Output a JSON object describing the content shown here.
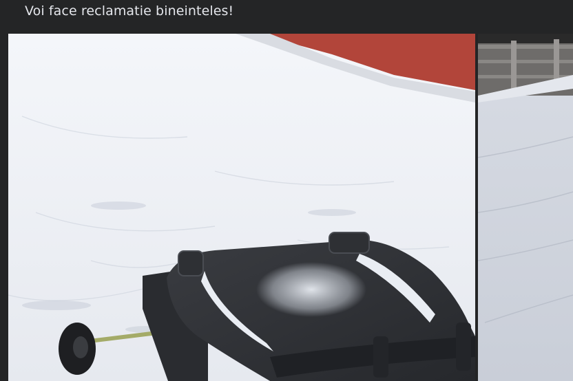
{
  "post": {
    "text": "Voi face reclamatie bineinteles!"
  },
  "photos": [
    {
      "description_icon": "photo-snow-trash-bin"
    },
    {
      "description_icon": "photo-snow-fence"
    }
  ],
  "colors": {
    "background": "#242526",
    "text": "#e4e6eb",
    "snow": "#eef1f6",
    "bin": "#2f3135",
    "wall": "#b2453a"
  }
}
